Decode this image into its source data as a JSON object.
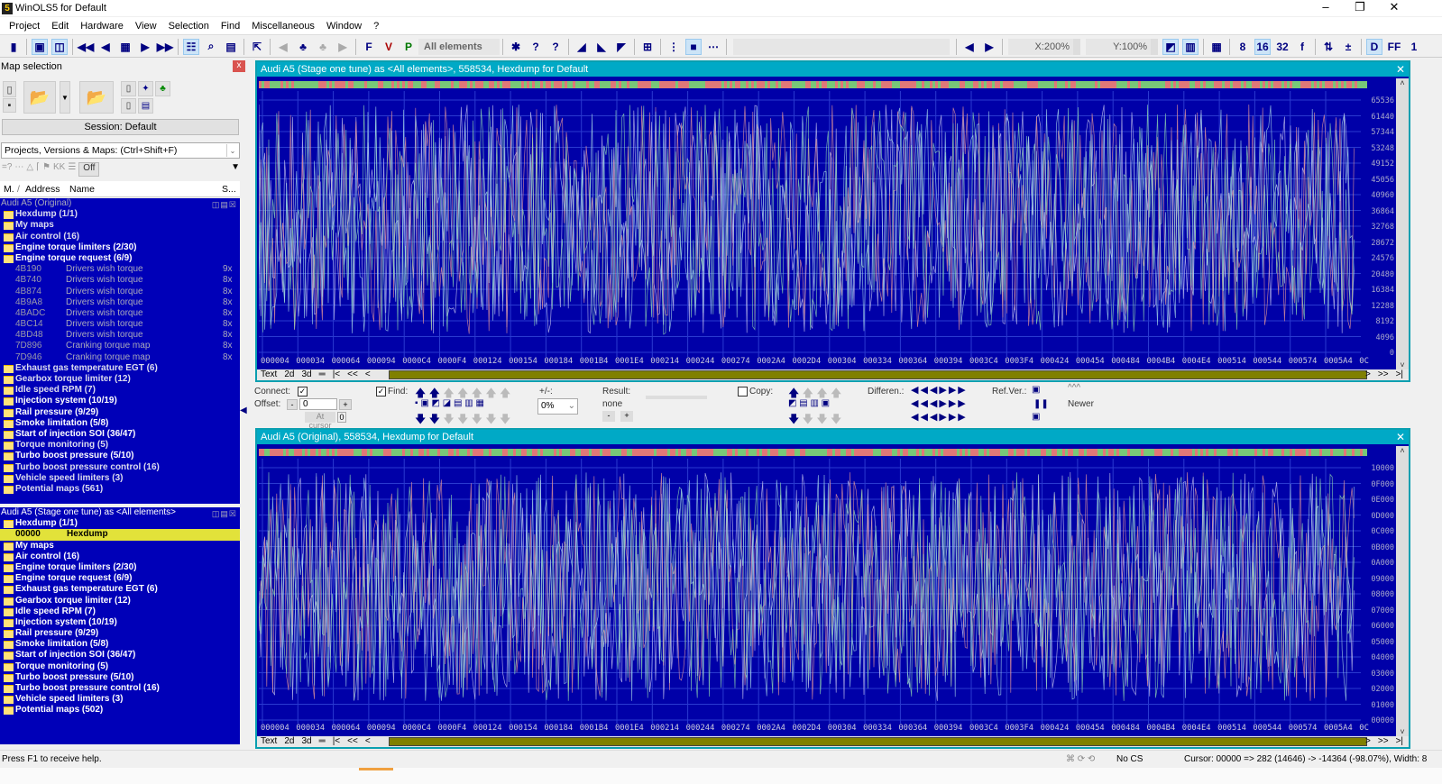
{
  "window": {
    "title": "WinOLS5 for Default",
    "app_icon": "5",
    "minimize": "–",
    "maximize": "❐",
    "close": "✕"
  },
  "menu": [
    "Project",
    "Edit",
    "Hardware",
    "View",
    "Selection",
    "Find",
    "Miscellaneous",
    "Window",
    "?"
  ],
  "toolbar": {
    "elements_label": "All elements",
    "x_zoom": "X:200%",
    "y_zoom": "Y:100%"
  },
  "map_selection": {
    "title": "Map selection",
    "close": "x",
    "session": "Session: Default",
    "filter_placeholder": "Projects, Versions & Maps:  (Ctrl+Shift+F)",
    "filter_off": "Off",
    "columns": {
      "m": "M.",
      "sort": "/",
      "address": "Address",
      "name": "Name",
      "size": "S..."
    }
  },
  "tree_original": {
    "header": "Audi A5 (Original)",
    "rows": [
      {
        "type": "folder",
        "label": "Hexdump (1/1)"
      },
      {
        "type": "folder",
        "label": "My maps"
      },
      {
        "type": "folder",
        "label": "Air control (16)"
      },
      {
        "type": "folder",
        "label": "Engine torque limiters (2/30)",
        "bright": true
      },
      {
        "type": "folder",
        "label": "Engine torque request (6/9)",
        "bright": true
      },
      {
        "type": "item",
        "address": "4B190",
        "name": "Drivers wish torque",
        "size": "9x"
      },
      {
        "type": "item",
        "address": "4B740",
        "name": "Drivers wish torque",
        "size": "8x"
      },
      {
        "type": "item",
        "address": "4B874",
        "name": "Drivers wish torque",
        "size": "8x"
      },
      {
        "type": "item",
        "address": "4B9A8",
        "name": "Drivers wish torque",
        "size": "8x"
      },
      {
        "type": "item",
        "address": "4BADC",
        "name": "Drivers wish torque",
        "size": "8x"
      },
      {
        "type": "item",
        "address": "4BC14",
        "name": "Drivers wish torque",
        "size": "8x"
      },
      {
        "type": "item",
        "address": "4BD48",
        "name": "Drivers wish torque",
        "size": "8x"
      },
      {
        "type": "item",
        "address": "7D896",
        "name": "Cranking torque map",
        "size": "8x"
      },
      {
        "type": "item",
        "address": "7D946",
        "name": "Cranking torque map",
        "size": "8x"
      },
      {
        "type": "folder",
        "label": "Exhaust gas temperature EGT (6)"
      },
      {
        "type": "folder",
        "label": "Gearbox torque limiter (12)"
      },
      {
        "type": "folder",
        "label": "Idle speed RPM (7)"
      },
      {
        "type": "folder",
        "label": "Injection system (10/19)",
        "bright": true
      },
      {
        "type": "folder",
        "label": "Rail pressure (9/29)",
        "bright": true
      },
      {
        "type": "folder",
        "label": "Smoke limitation (5/8)",
        "bright": true
      },
      {
        "type": "folder",
        "label": "Start of injection SOI (36/47)",
        "bright": true
      },
      {
        "type": "folder",
        "label": "Torque monitoring (5)"
      },
      {
        "type": "folder",
        "label": "Turbo boost pressure (5/10)",
        "bright": true
      },
      {
        "type": "folder",
        "label": "Turbo boost pressure control (16)"
      },
      {
        "type": "folder",
        "label": "Vehicle speed limiters (3)"
      },
      {
        "type": "folder",
        "label": "Potential maps (561)"
      }
    ]
  },
  "tree_tuned": {
    "header": "Audi A5 (Stage one tune) as <All elements>",
    "rows": [
      {
        "type": "folder",
        "label": "Hexdump (1/1)",
        "bright": true
      },
      {
        "type": "selected",
        "address": "00000",
        "name": "Hexdump"
      },
      {
        "type": "folder",
        "label": "My maps",
        "bright": true
      },
      {
        "type": "folder",
        "label": "Air control (16)",
        "bright": true
      },
      {
        "type": "folder",
        "label": "Engine torque limiters (2/30)",
        "bright": true
      },
      {
        "type": "folder",
        "label": "Engine torque request (6/9)",
        "bright": true
      },
      {
        "type": "folder",
        "label": "Exhaust gas temperature EGT (6)",
        "bright": true
      },
      {
        "type": "folder",
        "label": "Gearbox torque limiter (12)",
        "bright": true
      },
      {
        "type": "folder",
        "label": "Idle speed RPM (7)",
        "bright": true
      },
      {
        "type": "folder",
        "label": "Injection system (10/19)",
        "bright": true
      },
      {
        "type": "folder",
        "label": "Rail pressure (9/29)",
        "bright": true
      },
      {
        "type": "folder",
        "label": "Smoke limitation (5/8)",
        "bright": true
      },
      {
        "type": "folder",
        "label": "Start of injection SOI (36/47)",
        "bright": true
      },
      {
        "type": "folder",
        "label": "Torque monitoring (5)",
        "bright": true
      },
      {
        "type": "folder",
        "label": "Turbo boost pressure (5/10)",
        "bright": true
      },
      {
        "type": "folder",
        "label": "Turbo boost pressure control (16)",
        "bright": true
      },
      {
        "type": "folder",
        "label": "Vehicle speed limiters (3)",
        "bright": true
      },
      {
        "type": "folder",
        "label": "Potential maps (502)",
        "bright": true
      }
    ]
  },
  "top_window": {
    "title": "Audi A5 (Stage one tune) as <All elements>, 558534, Hexdump for Default",
    "y_ticks": [
      "65536",
      "61440",
      "57344",
      "53248",
      "49152",
      "45056",
      "40960",
      "36864",
      "32768",
      "28672",
      "24576",
      "20480",
      "16384",
      "12288",
      "8192",
      "4096",
      "0"
    ]
  },
  "bottom_window": {
    "title": "Audi A5 (Original), 558534, Hexdump for Default",
    "y_ticks": [
      "10000",
      "0F000",
      "0E000",
      "0D000",
      "0C000",
      "0B000",
      "0A000",
      "09000",
      "08000",
      "07000",
      "06000",
      "05000",
      "04000",
      "03000",
      "02000",
      "01000",
      "00000"
    ]
  },
  "x_ticks": [
    "000004",
    "000034",
    "000064",
    "000094",
    "0000C4",
    "0000F4",
    "000124",
    "000154",
    "000184",
    "0001B4",
    "0001E4",
    "000214",
    "000244",
    "000274",
    "0002A4",
    "0002D4",
    "000304",
    "000334",
    "000364",
    "000394",
    "0003C4",
    "0003F4",
    "000424",
    "000454",
    "000484",
    "0004B4",
    "0004E4",
    "000514",
    "000544",
    "000574",
    "0005A4",
    "0C"
  ],
  "view_tabs": [
    "Text",
    "2d",
    "3d",
    "═",
    "|<",
    "<<",
    "<"
  ],
  "view_nav_end": [
    ">",
    ">>",
    ">|"
  ],
  "controls": {
    "connect": "Connect:",
    "offset": "Offset:",
    "offset_value": "0",
    "minus": "-",
    "plus": "+",
    "at_cursor": "At cursor",
    "at_cursor_value": "0",
    "find": "Find:",
    "plusminus": "+/-:",
    "percent": "0%",
    "result": "Result:",
    "result_value": "none",
    "copy": "Copy:",
    "difference": "Differen.:",
    "ref_ver": "Ref.Ver.:",
    "ref_value": "^^^",
    "newer": "Newer"
  },
  "status": {
    "help": "Press F1 to receive help.",
    "cs": "No CS",
    "cursor": "Cursor: 00000 => 282 (14646) -> -14364 (-98.07%), Width: 8"
  },
  "colors": {
    "plot_bg": "#0000a8",
    "title_bar": "#00a9c6",
    "tree_bg": "#0000b8",
    "selected": "#e2e23a",
    "scrollbar": "#808000"
  }
}
